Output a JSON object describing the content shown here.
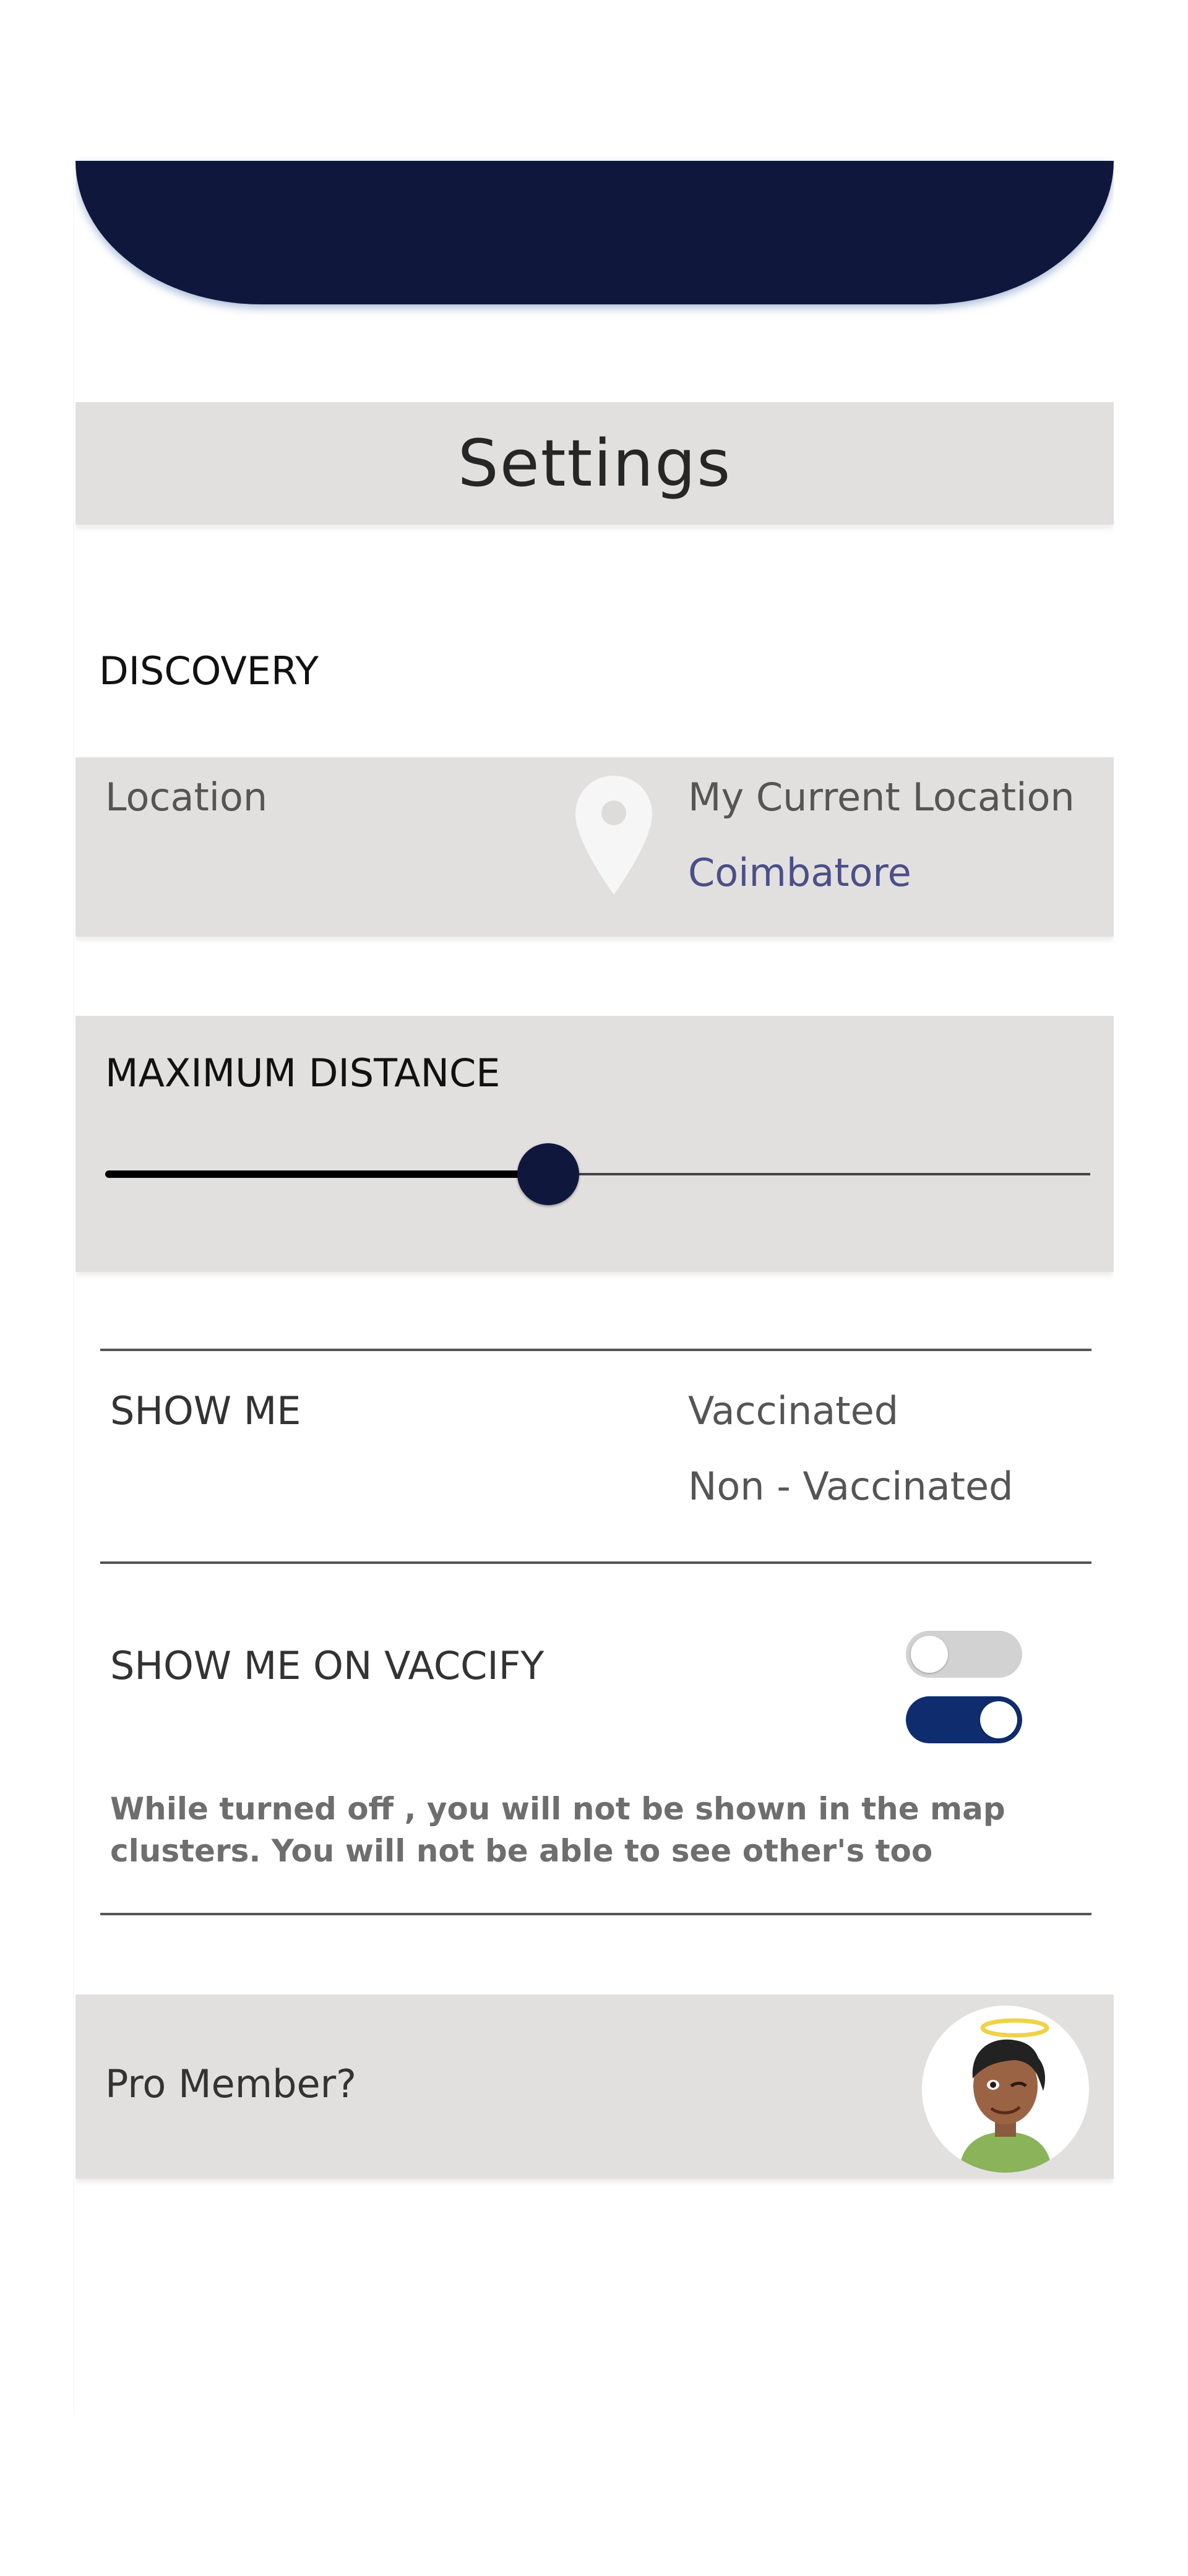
{
  "header": {
    "title": "Settings"
  },
  "discovery": {
    "heading": "DISCOVERY",
    "location_label": "Location",
    "location_icon": "map-pin-icon",
    "current_location": "My Current Location",
    "city": "Coimbatore"
  },
  "max_distance": {
    "heading": "MAXIMUM DISTANCE",
    "slider_fraction": 0.45
  },
  "show_me": {
    "label": "SHOW ME",
    "options": [
      "Vaccinated",
      "Non - Vaccinated"
    ]
  },
  "show_on_vaccify": {
    "label": "SHOW ME ON VACCIFY",
    "toggle_1_on": false,
    "toggle_2_on": true,
    "note": "While turned off , you will not be shown in the map clusters. You will not be able to see other's too"
  },
  "pro": {
    "label": "Pro Member?",
    "avatar_icon": "halo-avatar-icon"
  },
  "colors": {
    "navy": "#0f173d",
    "panel_gray": "#e2dfdf",
    "city_text": "#4a4f88",
    "toggle_on": "#0f2d6e",
    "toggle_off": "#d2d2d2"
  }
}
